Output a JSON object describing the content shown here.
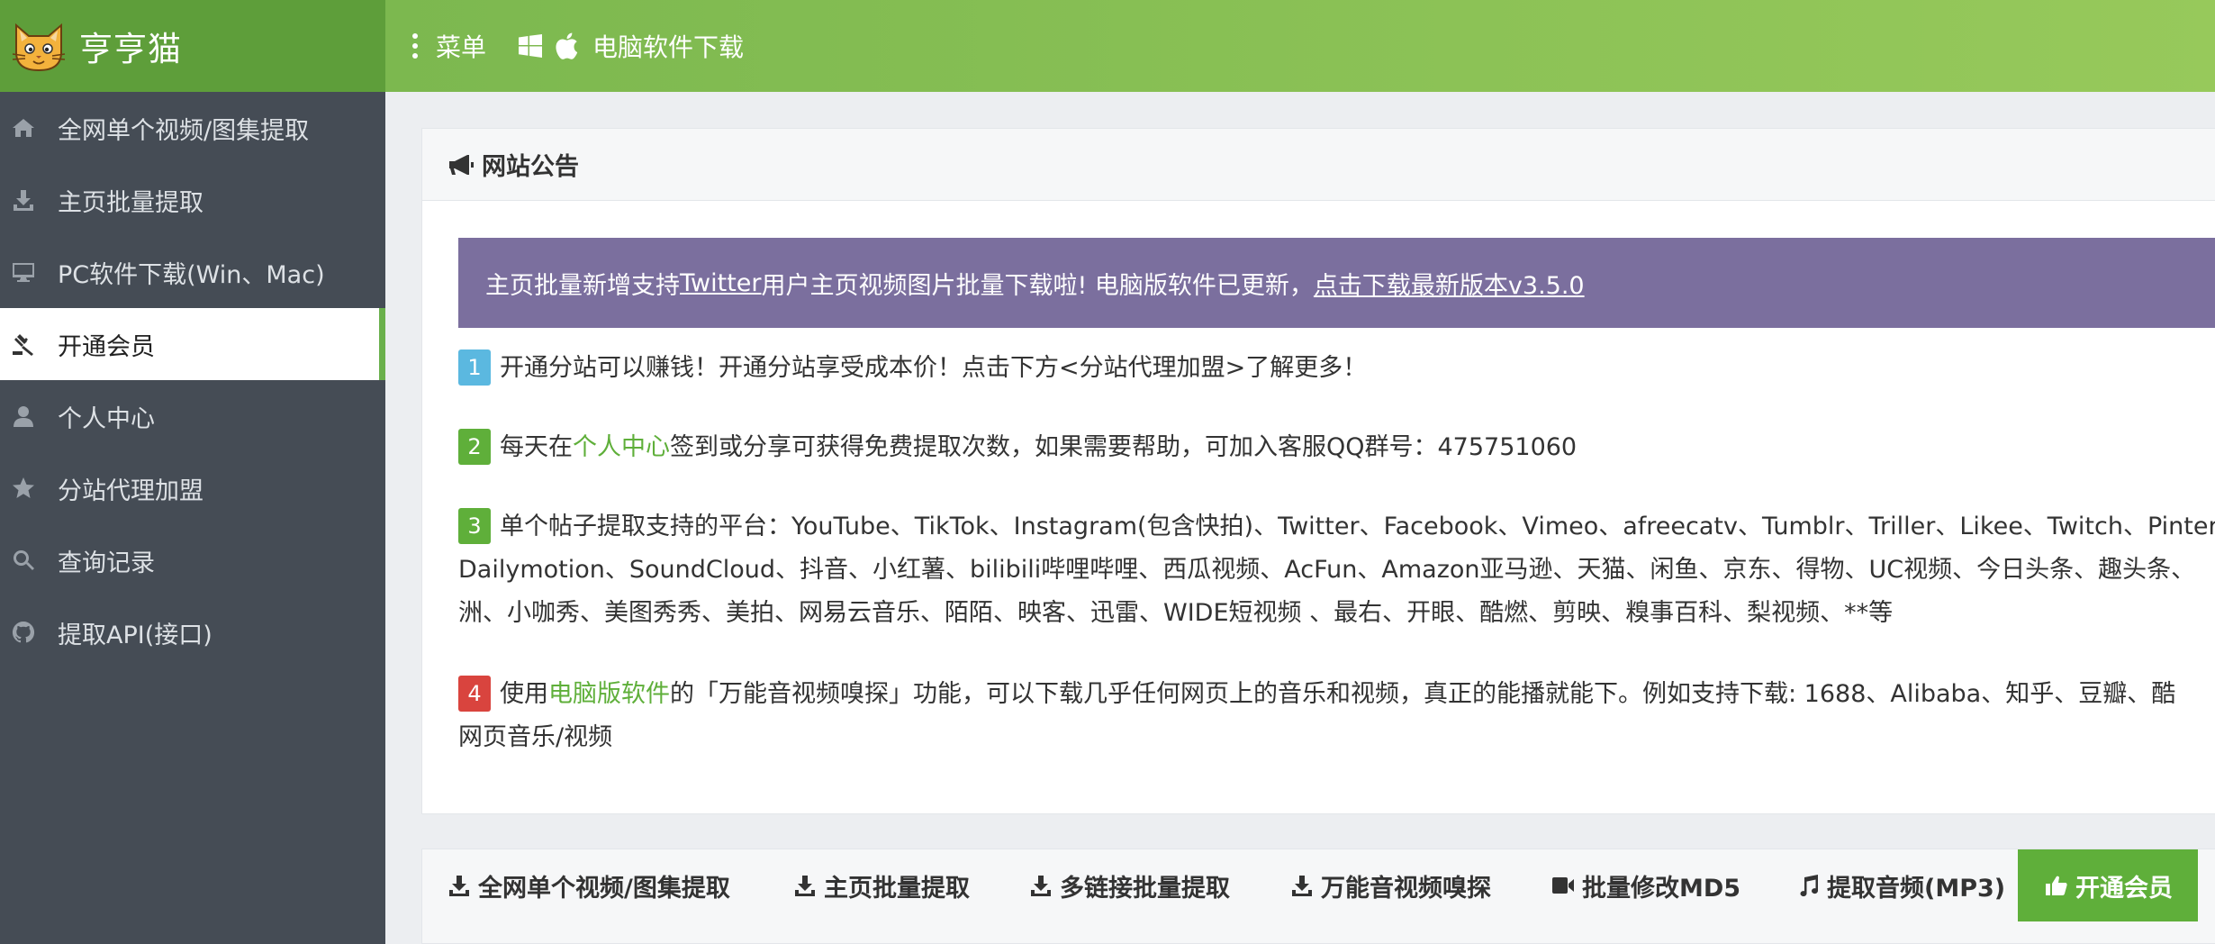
{
  "header": {
    "brand": "亨亨猫",
    "menu_label": "菜单",
    "software_label": "电脑软件下载"
  },
  "sidebar": {
    "items": [
      {
        "label": "全网单个视频/图集提取",
        "icon": "home-icon"
      },
      {
        "label": "主页批量提取",
        "icon": "download-icon"
      },
      {
        "label": "PC软件下载(Win、Mac)",
        "icon": "desktop-icon"
      },
      {
        "label": "开通会员",
        "icon": "gavel-icon",
        "active": true
      },
      {
        "label": "个人中心",
        "icon": "user-icon"
      },
      {
        "label": "分站代理加盟",
        "icon": "star-icon"
      },
      {
        "label": "查询记录",
        "icon": "search-icon"
      },
      {
        "label": "提取API(接口)",
        "icon": "github-icon"
      }
    ]
  },
  "notice": {
    "title": "网站公告",
    "banner": {
      "part1": "主页批量新增支持",
      "twitter_link": "Twitter",
      "part2": "用户主页视频图片批量下载啦! 电脑版软件已更新，",
      "download_link": "点击下载最新版本v3.5.0"
    },
    "items": [
      {
        "num": "1",
        "text": "开通分站可以赚钱！开通分站享受成本价！点击下方<分站代理加盟>了解更多！"
      },
      {
        "num": "2",
        "before": "每天在",
        "link": "个人中心",
        "after": "签到或分享可获得免费提取次数，如果需要帮助，可加入客服QQ群号：475751060"
      },
      {
        "num": "3",
        "line1": "单个帖子提取支持的平台：YouTube、TikTok、Instagram(包含快拍)、Twitter、Facebook、Vimeo、afreecatv、Tumblr、Triller、Likee、Twitch、Pinterest、",
        "line2": "Dailymotion、SoundCloud、抖音、小红薯、bilibili哔哩哔哩、西瓜视频、AcFun、Amazon亚马逊、天猫、闲鱼、京东、得物、UC视频、今日头条、趣头条、",
        "line3": "洲、小咖秀、美图秀秀、美拍、网易云音乐、陌陌、映客、迅雷、WIDE短视频 、最右、开眼、酷燃、剪映、糗事百科、梨视频、**等"
      },
      {
        "num": "4",
        "before": "使用",
        "link": "电脑版软件",
        "after": "的「万能音视频嗅探」功能，可以下载几乎任何网页上的音乐和视频，真正的能播就能下。例如支持下载: 1688、Alibaba、知乎、豆瓣、酷",
        "line2": "网页音乐/视频"
      }
    ]
  },
  "tabs": [
    {
      "label": "全网单个视频/图集提取",
      "icon": "download-icon"
    },
    {
      "label": "主页批量提取",
      "icon": "download-icon"
    },
    {
      "label": "多链接批量提取",
      "icon": "download-icon"
    },
    {
      "label": "万能音视频嗅探",
      "icon": "download-icon"
    },
    {
      "label": "批量修改MD5",
      "icon": "video-camera-icon"
    },
    {
      "label": "提取音频(MP3)",
      "icon": "music-icon"
    },
    {
      "label": "开通会员",
      "icon": "thumbs-up-icon",
      "active": true
    }
  ],
  "colors": {
    "brand_green": "#5e9e3a",
    "header_gradient_start": "#7cb84f",
    "header_gradient_end": "#97c95b",
    "sidebar_bg": "#454c55",
    "banner_purple": "#7b6f9e",
    "badge_blue": "#5bb8e0",
    "badge_green": "#5faf3a",
    "badge_red": "#d9443e",
    "link_green": "#5faf3a"
  }
}
